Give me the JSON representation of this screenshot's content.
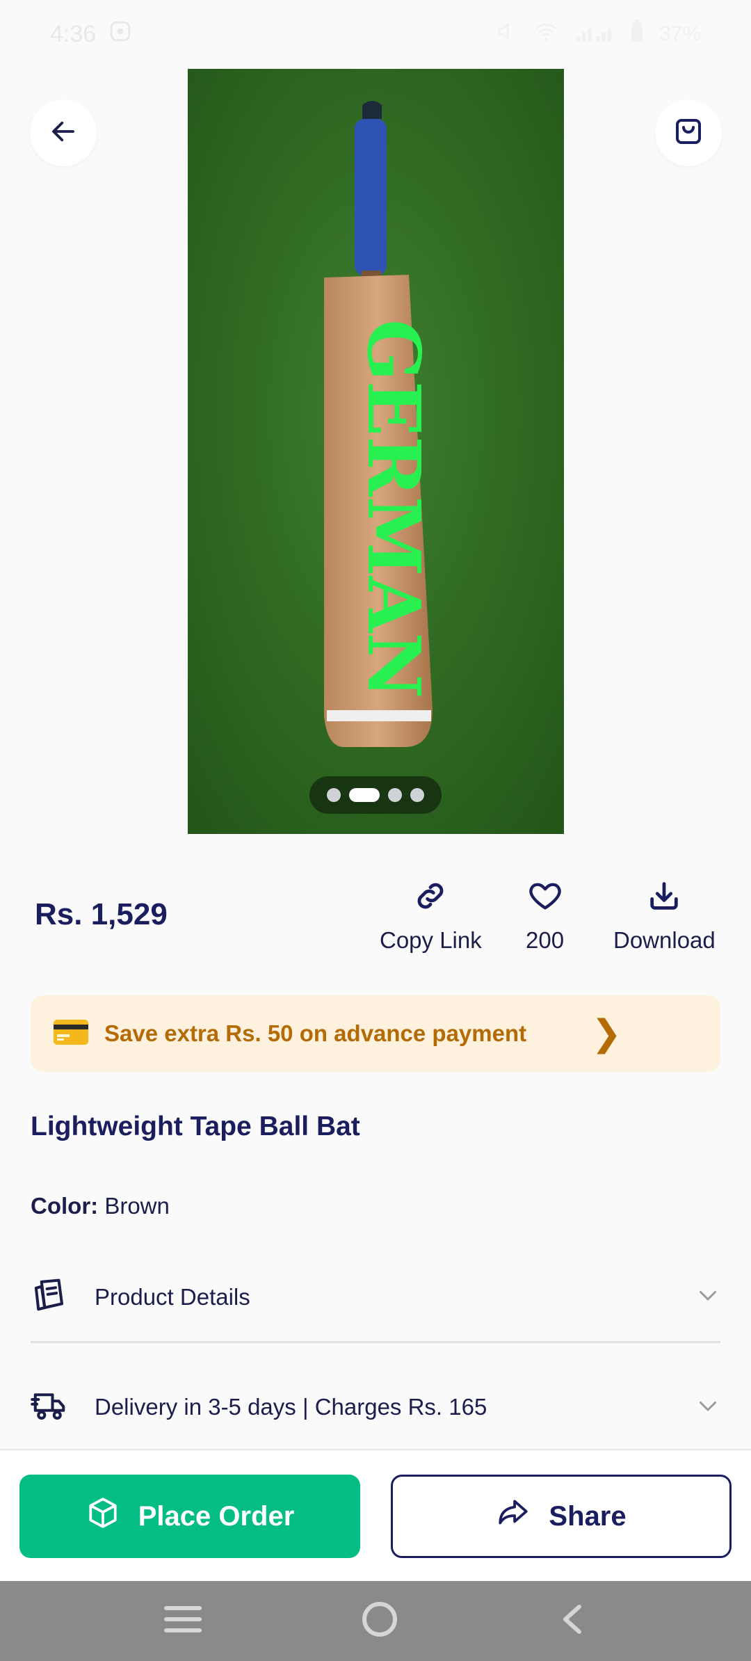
{
  "status_bar": {
    "time": "4:36",
    "battery": "37%"
  },
  "product": {
    "image_brand_text": "GERMAN",
    "image_count": 4,
    "active_image_index": 1,
    "price": "Rs. 1,529",
    "title": "Lightweight Tape Ball Bat",
    "color_label": "Color:",
    "color_value": "Brown"
  },
  "actions": {
    "copy_link": "Copy Link",
    "likes": "200",
    "download": "Download"
  },
  "offer": {
    "text": "Save extra Rs. 50 on advance payment",
    "icon": "credit-card-icon"
  },
  "accordions": {
    "details": "Product Details",
    "delivery": "Delivery in 3-5 days | Charges Rs. 165"
  },
  "buttons": {
    "place_order": "Place Order",
    "share": "Share"
  },
  "colors": {
    "primary": "#03bd84",
    "navy": "#1b1e5e",
    "offer_bg": "#fef2de",
    "offer_text": "#b46b06"
  }
}
